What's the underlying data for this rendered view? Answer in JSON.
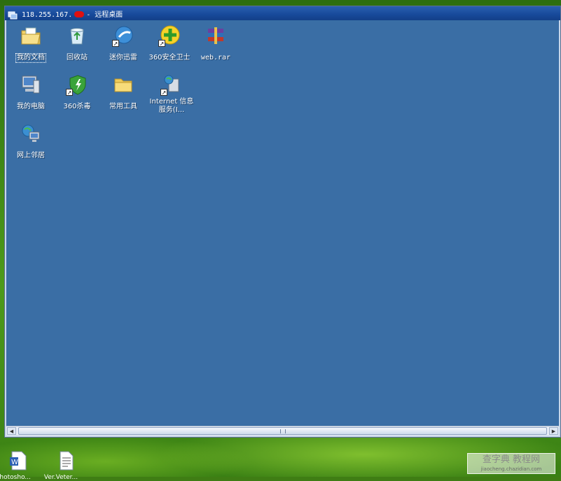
{
  "rdp_window": {
    "title_prefix": "118.255.167.",
    "title_suffix": "- 远程桌面"
  },
  "remote_desktop": {
    "icons": [
      {
        "label": "我的文档",
        "icon": "my-documents-icon",
        "selected": true
      },
      {
        "label": "回收站",
        "icon": "recycle-bin-icon"
      },
      {
        "label": "迷你迅雷",
        "icon": "mini-thunder-icon",
        "shortcut": true
      },
      {
        "label": "360安全卫士",
        "icon": "360-safe-icon",
        "shortcut": true
      },
      {
        "label": "web.rar",
        "icon": "winrar-archive-icon"
      },
      {
        "label": "我的电脑",
        "icon": "my-computer-icon"
      },
      {
        "label": "360杀毒",
        "icon": "360-antivirus-icon",
        "shortcut": true
      },
      {
        "label": "常用工具",
        "icon": "folder-icon"
      },
      {
        "label": "Internet 信息服务(I...",
        "icon": "iis-icon",
        "shortcut": true
      },
      {
        "label": "网上邻居",
        "icon": "network-places-icon"
      }
    ]
  },
  "scrollbar": {
    "grip": "|||"
  },
  "local_desktop": {
    "icons": [
      {
        "label": "Photosho...",
        "icon": "word-document-icon"
      },
      {
        "label": "Ver.Veter...",
        "icon": "text-document-icon"
      }
    ]
  },
  "watermark": {
    "main": "查字典 教程网",
    "sub": "jiaocheng.chazidian.com"
  },
  "colors": {
    "remote_bg": "#3a6ea5",
    "titlebar": "#1b4f9f",
    "outer_bg": "#3f7d14"
  }
}
